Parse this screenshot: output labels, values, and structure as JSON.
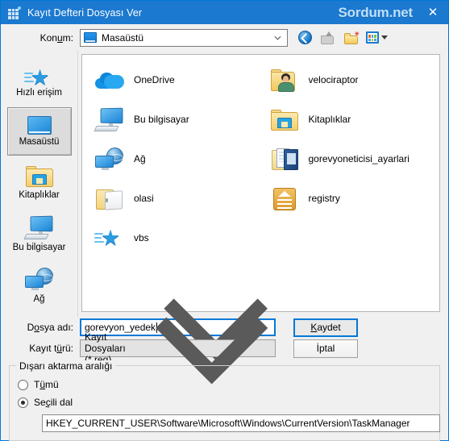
{
  "window": {
    "title": "Kayıt Defteri Dosyası Ver",
    "watermark": "Sordum.net",
    "close_label": "✕",
    "title_icon": "registry-editor-icon",
    "accent_color": "#1b79d0",
    "focus_color": "#0078d7"
  },
  "location": {
    "label_pre": "Kon",
    "label_accel": "u",
    "label_post": "m:",
    "value": "Masaüstü",
    "icon": "desktop-monitor-icon",
    "toolbar": [
      {
        "name": "back-button",
        "tooltip": "Geri"
      },
      {
        "name": "up-button",
        "tooltip": "Yukarı"
      },
      {
        "name": "new-folder-button",
        "tooltip": "Yeni klasör"
      },
      {
        "name": "view-button",
        "tooltip": "Görünüm"
      }
    ]
  },
  "places": [
    {
      "label": "Hızlı erişim",
      "icon": "quick-access-star-icon",
      "selected": false
    },
    {
      "label": "Masaüstü",
      "icon": "desktop-monitor-icon",
      "selected": true
    },
    {
      "label": "Kitaplıklar",
      "icon": "libraries-folder-icon",
      "selected": false
    },
    {
      "label": "Bu bilgisayar",
      "icon": "this-pc-icon",
      "selected": false
    },
    {
      "label": "Ağ",
      "icon": "network-icon",
      "selected": false
    }
  ],
  "files": [
    {
      "name": "OneDrive",
      "icon": "onedrive-cloud-icon"
    },
    {
      "name": "velociraptor",
      "icon": "user-folder-icon"
    },
    {
      "name": "Bu bilgisayar",
      "icon": "this-pc-icon"
    },
    {
      "name": "Kitaplıklar",
      "icon": "libraries-folder-icon"
    },
    {
      "name": "Ağ",
      "icon": "network-icon"
    },
    {
      "name": "gorevyoneticisi_ayarlari",
      "icon": "document-folder-icon"
    },
    {
      "name": "olasi",
      "icon": "open-folder-icon"
    },
    {
      "name": "registry",
      "icon": "registry-file-icon"
    },
    {
      "name": "vbs",
      "icon": "shortcut-star-icon"
    }
  ],
  "form": {
    "filename_label_pre": "D",
    "filename_label_accel": "o",
    "filename_label_post": "sya adı:",
    "filename_value": "gorevyon_yedek",
    "filetype_label_pre": "Kayıt t",
    "filetype_label_accel": "ü",
    "filetype_label_post": "rü:",
    "filetype_value": "Kayıt Dosyaları (*.reg)",
    "save_label_pre": "",
    "save_label_accel": "K",
    "save_label_post": "aydet",
    "cancel_label": "İptal"
  },
  "export_range": {
    "title": "Dışarı aktarma aralığı",
    "options": [
      {
        "label_pre": "T",
        "label_accel": "ü",
        "label_post": "mü",
        "selected": false
      },
      {
        "label_pre": "Se",
        "label_accel": "ç",
        "label_post": "ili dal",
        "selected": true
      }
    ],
    "path": "HKEY_CURRENT_USER\\Software\\Microsoft\\Windows\\CurrentVersion\\TaskManager"
  }
}
